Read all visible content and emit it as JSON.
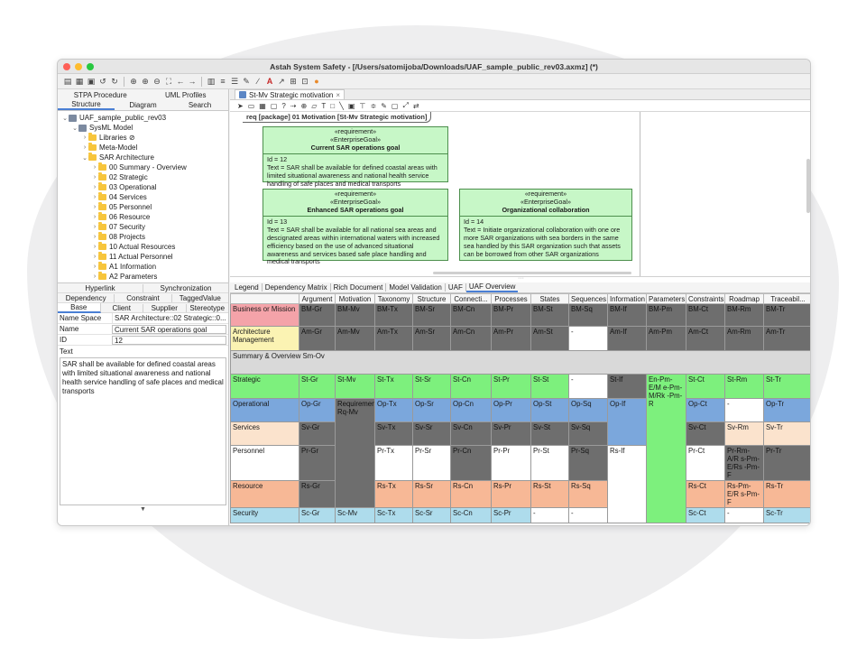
{
  "window": {
    "title": "Astah System Safety - [/Users/satomijoba/Downloads/UAF_sample_public_rev03.axmz] (*)"
  },
  "left_tabs_top": [
    "STPA Procedure",
    "UML Profiles"
  ],
  "left_tabs": [
    "Structure",
    "Diagram",
    "Search"
  ],
  "tree": [
    {
      "label": "UAF_sample_public_rev03",
      "level": 0,
      "icon": "project-icon",
      "chev": "⌄"
    },
    {
      "label": "SysML Model",
      "level": 1,
      "icon": "model-icon",
      "chev": "⌄"
    },
    {
      "label": "Libraries ⊘",
      "level": 2,
      "icon": "folder-icon",
      "chev": "›"
    },
    {
      "label": "Meta-Model",
      "level": 2,
      "icon": "folder-icon",
      "chev": "›"
    },
    {
      "label": "SAR Architecture",
      "level": 2,
      "icon": "folder-icon",
      "chev": "⌄"
    },
    {
      "label": "00 Summary - Overview",
      "level": 3,
      "icon": "folder-icon",
      "chev": "›"
    },
    {
      "label": "02 Strategic",
      "level": 3,
      "icon": "folder-icon",
      "chev": "›"
    },
    {
      "label": "03 Operational",
      "level": 3,
      "icon": "folder-icon",
      "chev": "›"
    },
    {
      "label": "04 Services",
      "level": 3,
      "icon": "folder-icon",
      "chev": "›"
    },
    {
      "label": "05 Personnel",
      "level": 3,
      "icon": "folder-icon",
      "chev": "›"
    },
    {
      "label": "06 Resource",
      "level": 3,
      "icon": "folder-icon",
      "chev": "›"
    },
    {
      "label": "07 Security",
      "level": 3,
      "icon": "folder-icon",
      "chev": "›"
    },
    {
      "label": "08 Projects",
      "level": 3,
      "icon": "folder-icon",
      "chev": "›"
    },
    {
      "label": "10 Actual Resources",
      "level": 3,
      "icon": "folder-icon",
      "chev": "›"
    },
    {
      "label": "11 Actual Personnel",
      "level": 3,
      "icon": "folder-icon",
      "chev": "›"
    },
    {
      "label": "A1 Information",
      "level": 3,
      "icon": "folder-icon",
      "chev": "›"
    },
    {
      "label": "A2 Parameters",
      "level": 3,
      "icon": "folder-icon",
      "chev": "›"
    }
  ],
  "prop_tabs_1": [
    "Hyperlink",
    "Synchronization"
  ],
  "prop_tabs_2": [
    "Dependency",
    "Constraint",
    "TaggedValue"
  ],
  "prop_tabs_3": [
    "Base",
    "Client",
    "Supplier",
    "Stereotype"
  ],
  "props": {
    "namespace_label": "Name Space",
    "namespace_value": "SAR Architecture::02 Strategic::0...",
    "name_label": "Name",
    "name_value": "Current SAR operations goal",
    "id_label": "ID",
    "id_value": "12",
    "text_label": "Text",
    "text_value": "SAR shall be available for defined coastal areas with limited situational awareness and national health service handling of safe places and medical transports"
  },
  "diagram": {
    "tab_label": "St-Mv Strategic motivation",
    "frame_label": "req [package] 01 Motivation [St-Mv Strategic motivation]",
    "requirements": [
      {
        "stereo1": "«requirement»",
        "stereo2": "«EnterpriseGoal»",
        "name": "Current SAR operations goal",
        "id": "Id = 12",
        "text": "Text = SAR shall be available for defined coastal areas with limited situational awareness and national health service handling of safe places and medical transports"
      },
      {
        "stereo1": "«requirement»",
        "stereo2": "«EnterpriseGoal»",
        "name": "Enhanced SAR operations goal",
        "id": "Id = 13",
        "text": "Text = SAR shall be available for all national sea areas and descignated areas within international waters with increased efficiency based on the use of advanced situational awareness and services based safe place handling and medical transports"
      },
      {
        "stereo1": "«requirement»",
        "stereo2": "«EnterpriseGoal»",
        "name": "Organizational collaboration",
        "id": "Id = 14",
        "text": "Text = Initiate organizational collaboration with one ore more SAR organizations with sea borders in the same sea handled by this SAR organization such that assets can be borrowed from other SAR organizations"
      }
    ]
  },
  "bottom_tabs": [
    "Legend",
    "Dependency Matrix",
    "Rich Document",
    "Model Validation",
    "UAF",
    "UAF Overview"
  ],
  "uaf": {
    "columns": [
      "",
      "Argument",
      "Motivation",
      "Taxonomy",
      "Structure",
      "Connecti...",
      "Processes",
      "States",
      "Sequences",
      "Information",
      "Parameters",
      "Constraints",
      "Roadmap",
      "Traceabil..."
    ],
    "summary_label": "Summary & Overview Sm-Ov",
    "rows": {
      "bm": [
        "Business or Mission",
        "BM-Gr",
        "BM-Mv",
        "BM-Tx",
        "BM-Sr",
        "BM-Cn",
        "BM-Pr",
        "BM-St",
        "BM-Sq",
        "BM-If",
        "BM-Pm",
        "BM-Ct",
        "BM-Rm",
        "BM-Tr"
      ],
      "am": [
        "Architecture Management",
        "Am-Gr",
        "Am-Mv",
        "Am-Tx",
        "Am-Sr",
        "Am-Cn",
        "Am-Pr",
        "Am-St",
        "-",
        "Am-If",
        "Am-Pm",
        "Am-Ct",
        "Am-Rm",
        "Am-Tr"
      ],
      "st": [
        "Strategic",
        "St-Gr",
        "St-Mv",
        "St-Tx",
        "St-Sr",
        "St-Cn",
        "St-Pr",
        "St-St",
        "-",
        "St-If",
        "En-Pm-E/M e-Pm-M/Rk -Pm-R",
        "St-Ct",
        "St-Rm",
        "St-Tr"
      ],
      "op": [
        "Operational",
        "Op-Gr",
        "Requirements Rq-Mv",
        "Op-Tx",
        "Op-Sr",
        "Op-Cn",
        "Op-Pr",
        "Op-St",
        "Op-Sq",
        "Op-If",
        "",
        "Op-Ct",
        "-",
        "Op-Tr"
      ],
      "sv": [
        "Services",
        "Sv-Gr",
        "",
        "Sv-Tx",
        "Sv-Sr",
        "Sv-Cn",
        "Sv-Pr",
        "Sv-St",
        "Sv-Sq",
        "",
        "",
        "Sv-Ct",
        "Sv-Rm",
        "Sv-Tr"
      ],
      "pr": [
        "Personnel",
        "Pr-Gr",
        "",
        "Pr-Tx",
        "Pr-Sr",
        "Pr-Cn",
        "Pr-Pr",
        "Pr-St",
        "Pr-Sq",
        "Rs-If",
        "",
        "Pr-Ct",
        "Pr-Rm-A/R s-Pm-E/Rs -Pm-F",
        "Pr-Tr"
      ],
      "rs": [
        "Resource",
        "Rs-Gr",
        "",
        "Rs-Tx",
        "Rs-Sr",
        "Rs-Cn",
        "Rs-Pr",
        "Rs-St",
        "Rs-Sq",
        "",
        "",
        "Rs-Ct",
        "Rs-Pm-E/R s-Pm-F",
        "Rs-Tr"
      ],
      "sc": [
        "Security",
        "Sc-Gr",
        "Sc-Mv",
        "Sc-Tx",
        "Sc-Sr",
        "Sc-Cn",
        "Sc-Pr",
        "-",
        "-",
        "",
        "",
        "Sc-Ct",
        "-",
        "Sc-Tr"
      ]
    }
  },
  "colors": {
    "business": "#f4a3a9",
    "architecture": "#fbf3b3",
    "strategic": "#7df07d",
    "operational": "#7ba7dc",
    "services": "#fbe3cd",
    "resource": "#f7b896",
    "security": "#aedcec",
    "dark": "#6e6e6e"
  }
}
